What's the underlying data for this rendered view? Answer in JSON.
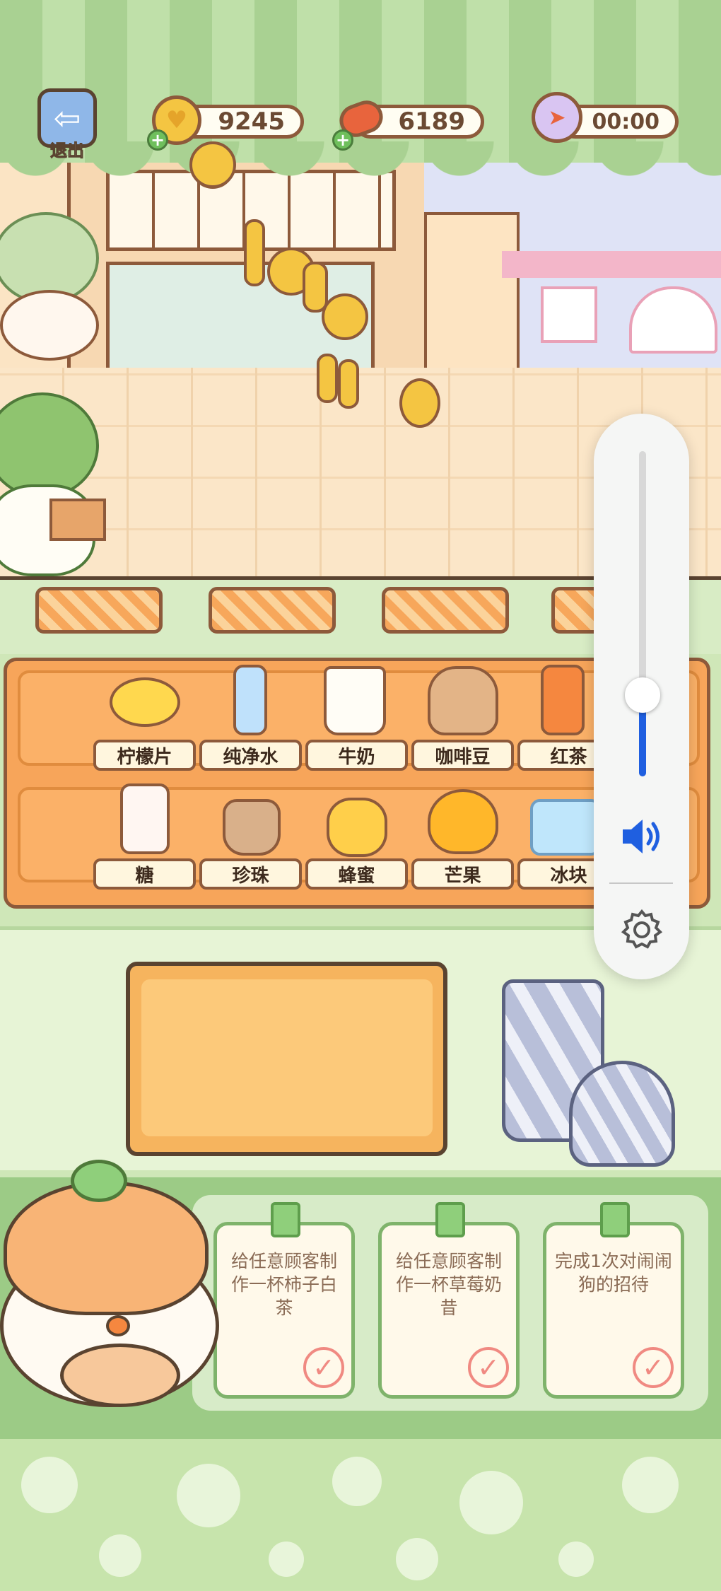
{
  "hud": {
    "exit_label": "退出",
    "coins": "9245",
    "meat": "6189",
    "timer": "00:00"
  },
  "ingredients": {
    "row1": [
      "柠檬片",
      "纯净水",
      "牛奶",
      "咖啡豆",
      "红茶"
    ],
    "row2": [
      "糖",
      "珍珠",
      "蜂蜜",
      "芒果",
      "冰块"
    ]
  },
  "tasks": [
    {
      "text": "给任意顾客制作一杯柿子白茶"
    },
    {
      "text": "给任意顾客制作一杯草莓奶昔"
    },
    {
      "text": "完成1次对闹闹狗的招待"
    }
  ],
  "volume": {
    "level_fraction": 0.25,
    "accent": "#1f5fe0"
  },
  "icons": [
    "exit-icon",
    "coin-icon",
    "meat-icon",
    "timer-icon",
    "speaker-icon",
    "gear-icon",
    "check-icon"
  ]
}
